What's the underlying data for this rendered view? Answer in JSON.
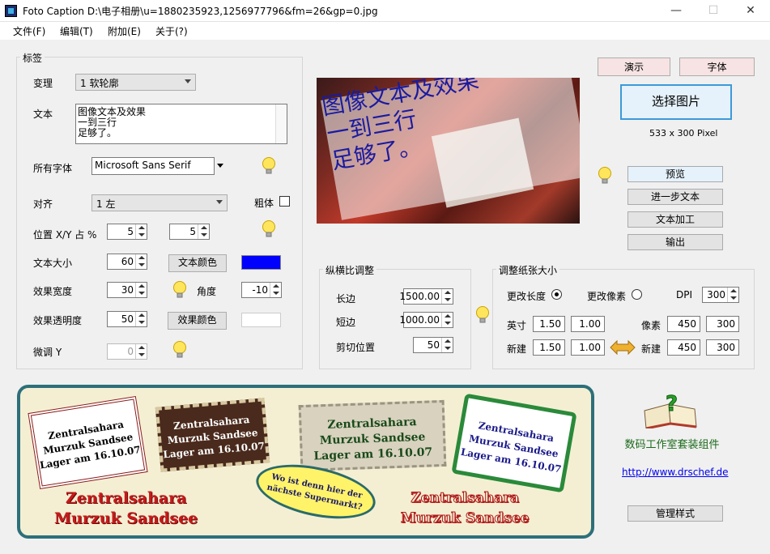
{
  "window": {
    "title": "Foto Caption D:\\电子相册\\u=1880235923,1256977796&fm=26&gp=0.jpg"
  },
  "menu": [
    "文件(F)",
    "编辑(T)",
    "附加(E)",
    "关于(?)"
  ],
  "label_group": {
    "title": "标签",
    "variation_label": "变理",
    "variation_value": "1 软轮廓",
    "text_label": "文本",
    "text_value": "图像文本及效果\n一到三行\n足够了。",
    "font_label": "所有字体",
    "font_value": "Microsoft Sans Serif",
    "align_label": "对齐",
    "align_value": "1 左",
    "bold_label": "粗体",
    "position_label": "位置 X/Y 占 %",
    "pos_x": "5",
    "pos_y": "5",
    "size_label": "文本大小",
    "size_value": "60",
    "text_color_btn": "文本颜色",
    "text_color": "#0000ff",
    "effect_width_label": "效果宽度",
    "effect_width_value": "30",
    "angle_label": "角度",
    "angle_value": "-10",
    "effect_alpha_label": "效果透明度",
    "effect_alpha_value": "50",
    "effect_color_btn": "效果颜色",
    "effect_color": "#ffffff",
    "fine_label": "微调 Y",
    "fine_value": "0"
  },
  "preview": {
    "caption_lines": [
      "图像文本及效果",
      "一到三行",
      "足够了。"
    ]
  },
  "right_panel": {
    "demo_btn": "演示",
    "font_btn": "字体",
    "select_image_btn": "选择图片",
    "pixel_info": "533 x 300 Pixel",
    "preview_btn": "预览",
    "more_text_btn": "进一步文本",
    "text_process_btn": "文本加工",
    "output_btn": "输出"
  },
  "aspect_group": {
    "title": "纵横比调整",
    "long_label": "长边",
    "long_value": "1500.00",
    "short_label": "短边",
    "short_value": "1000.00",
    "crop_label": "剪切位置",
    "crop_value": "50"
  },
  "paper_group": {
    "title": "调整纸张大小",
    "change_length": "更改长度",
    "change_pixels": "更改像素",
    "dpi_label": "DPI",
    "dpi_value": "300",
    "inch_label": "英寸",
    "inch_w": "1.50",
    "inch_h": "1.00",
    "pixel_label": "像素",
    "pixel_w": "450",
    "pixel_h": "300",
    "new_label": "新建",
    "new_inch_w": "1.50",
    "new_inch_h": "1.00",
    "new_label2": "新建",
    "new_pixel_w": "450",
    "new_pixel_h": "300"
  },
  "banner": {
    "stamp1": [
      "Zentralsahara",
      "Murzuk Sandsee",
      "Lager am 16.10.07"
    ],
    "stamp2": [
      "Zentralsahara",
      "Murzuk Sandsee",
      "Lager am 16.10.07"
    ],
    "stamp3": [
      "Zentralsahara",
      "Murzuk Sandsee",
      "Lager am 16.10.07"
    ],
    "stamp4": [
      "Zentralsahara",
      "Murzuk Sandsee",
      "Lager am 16.10.07"
    ],
    "bubble": [
      "Wo ist denn hier der",
      "nächste Supermarkt?"
    ],
    "bottom_left": [
      "Zentralsahara",
      "Murzuk Sandsee"
    ],
    "bottom_right": [
      "Zentralsahara",
      "Murzuk Sandsee"
    ]
  },
  "company": {
    "name": "数码工作室套装组件",
    "url": "http://www.drschef.de",
    "manage_btn": "管理样式"
  }
}
